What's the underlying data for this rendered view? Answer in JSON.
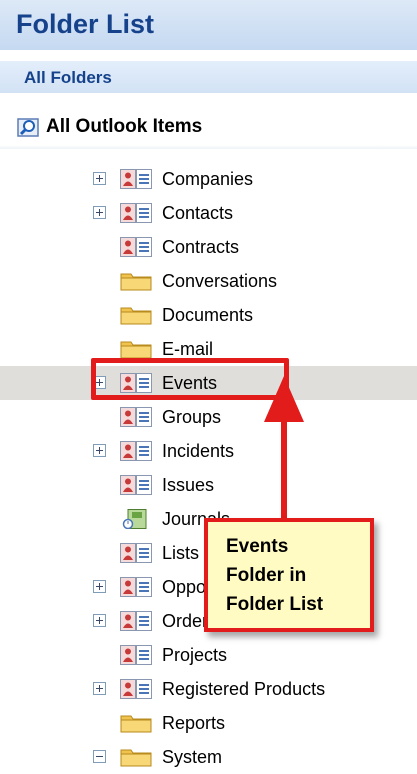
{
  "header": {
    "title": "Folder List"
  },
  "subheader": {
    "title": "All Folders"
  },
  "root": {
    "label": "All Outlook Items",
    "icon": "search-folder-icon"
  },
  "tree": {
    "items": [
      {
        "label": "Companies",
        "icon": "contact-card-icon",
        "expander": "plus"
      },
      {
        "label": "Contacts",
        "icon": "contact-card-icon",
        "expander": "plus"
      },
      {
        "label": "Contracts",
        "icon": "contact-card-icon",
        "expander": "none"
      },
      {
        "label": "Conversations",
        "icon": "folder-icon",
        "expander": "none"
      },
      {
        "label": "Documents",
        "icon": "folder-icon",
        "expander": "none"
      },
      {
        "label": "E-mail",
        "icon": "folder-icon",
        "expander": "none"
      },
      {
        "label": "Events",
        "icon": "contact-card-icon",
        "expander": "plus",
        "selected": true
      },
      {
        "label": "Groups",
        "icon": "contact-card-icon",
        "expander": "none"
      },
      {
        "label": "Incidents",
        "icon": "contact-card-icon",
        "expander": "plus"
      },
      {
        "label": "Issues",
        "icon": "contact-card-icon",
        "expander": "none"
      },
      {
        "label": "Journals",
        "icon": "journal-icon",
        "expander": "none"
      },
      {
        "label": "Lists",
        "icon": "contact-card-icon",
        "expander": "none"
      },
      {
        "label": "Opportunities",
        "icon": "contact-card-icon",
        "expander": "plus"
      },
      {
        "label": "Orders",
        "icon": "contact-card-icon",
        "expander": "plus"
      },
      {
        "label": "Projects",
        "icon": "contact-card-icon",
        "expander": "none"
      },
      {
        "label": "Registered Products",
        "icon": "contact-card-icon",
        "expander": "plus"
      },
      {
        "label": "Reports",
        "icon": "folder-icon",
        "expander": "none"
      },
      {
        "label": "System",
        "icon": "folder-icon",
        "expander": "minus"
      }
    ]
  },
  "callout": {
    "lines": [
      "Events",
      "Folder in",
      "Folder List"
    ],
    "accent_color": "#e21b1b",
    "background_color": "#fffbc2"
  }
}
